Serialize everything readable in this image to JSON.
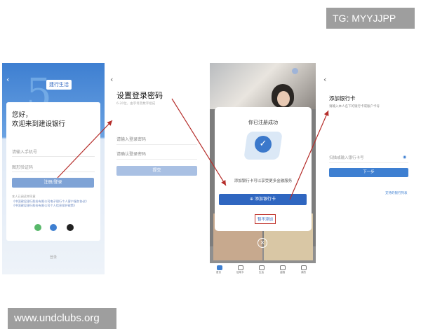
{
  "watermarks": {
    "top_right": "TG: MYYJJPP",
    "bottom_left": "www.undclubs.org"
  },
  "screen1": {
    "badge": "建行生活",
    "big_digit": "5",
    "greeting_line1": "您好，",
    "greeting_line2": "欢迎来到建设银行",
    "phone_placeholder": "请输入手机号",
    "code_placeholder": "图形验证码",
    "login_button": "注册/登录",
    "agreement_line1": "本人已阅读并同意",
    "agreement_line2": "《中国建设银行股份有限公司电子银行个人客户服务协议》",
    "agreement_line3": "《中国建设银行股份有限公司个人信息保护政策》",
    "footer": "登录"
  },
  "screen2": {
    "title": "设置登录密码",
    "subtitle": "6-20位，由字母及数字组成",
    "password_placeholder": "请输入登录密码",
    "confirm_placeholder": "请确认登录密码",
    "submit_button": "提交"
  },
  "screen3": {
    "modal_title": "你已注册成功",
    "modal_text": "添加银行卡可以享受更多金融服务",
    "add_card_button": "⊕ 添加银行卡",
    "skip_link": "暂不添加",
    "tabs": [
      "首页",
      "信用卡",
      "生活",
      "金融",
      "我的"
    ]
  },
  "screen4": {
    "title": "添加银行卡",
    "subtitle": "请输入本人名下的银行卡或账户卡号",
    "card_placeholder": "扫描或输入银行卡号",
    "next_button": "下一步",
    "supported_banks_link": "支持的银行列表"
  },
  "colors": {
    "primary": "#2f66c0",
    "arrow": "#b52d2a",
    "watermark_bg": "#9e9e9e"
  }
}
